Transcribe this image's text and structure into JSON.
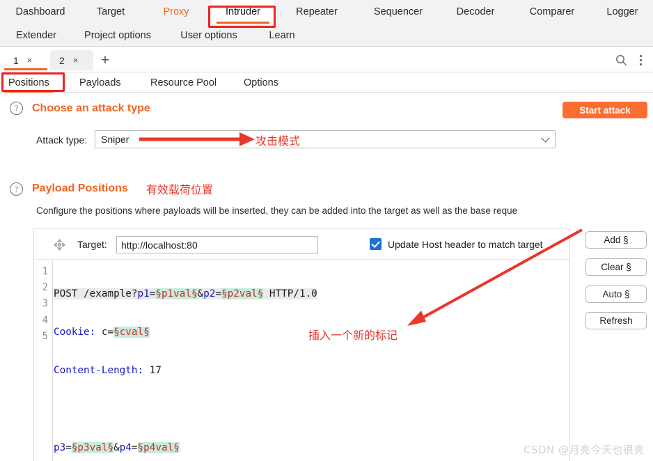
{
  "menu": {
    "row1": [
      {
        "label": "Dashboard",
        "state": "normal"
      },
      {
        "label": "Target",
        "state": "normal"
      },
      {
        "label": "Proxy",
        "state": "highlight"
      },
      {
        "label": "Intruder",
        "state": "active"
      },
      {
        "label": "Repeater",
        "state": "normal"
      },
      {
        "label": "Sequencer",
        "state": "normal"
      },
      {
        "label": "Decoder",
        "state": "normal"
      },
      {
        "label": "Comparer",
        "state": "normal"
      },
      {
        "label": "Logger",
        "state": "normal"
      }
    ],
    "row2": [
      {
        "label": "Extender",
        "state": "normal"
      },
      {
        "label": "Project options",
        "state": "normal"
      },
      {
        "label": "User options",
        "state": "normal"
      },
      {
        "label": "Learn",
        "state": "normal"
      }
    ]
  },
  "attack_tabs": {
    "tabs": [
      {
        "label": "1",
        "close": "×",
        "selected": true
      },
      {
        "label": "2",
        "close": "×",
        "selected": false
      }
    ],
    "add_label": "+",
    "search_icon": "search-icon",
    "menu_icon": "kebab-menu-icon"
  },
  "sub_tabs": [
    {
      "label": "Positions",
      "selected": true
    },
    {
      "label": "Payloads",
      "selected": false
    },
    {
      "label": "Resource Pool",
      "selected": false
    },
    {
      "label": "Options",
      "selected": false
    }
  ],
  "attack_type_section": {
    "help_icon": "?",
    "title": "Choose an attack type",
    "start_attack_label": "Start attack",
    "field_label": "Attack type:",
    "selected_value": "Sniper",
    "annotation_cn": "攻击模式"
  },
  "payload_positions_section": {
    "help_icon": "?",
    "title": "Payload Positions",
    "annotation_cn": "有效载荷位置",
    "description": "Configure the positions where payloads will be inserted, they can be added into the target as well as the base reque"
  },
  "editor": {
    "move_icon": "move-handle-icon",
    "target_label": "Target:",
    "target_value": "http://localhost:80",
    "checkbox_checked": true,
    "checkbox_label": "Update Host header to match target",
    "line_numbers": [
      "1",
      "2",
      "3",
      "4",
      "5"
    ],
    "request_lines": [
      "POST /example?p1=§p1val§&p2=§p2val§ HTTP/1.0",
      "Cookie: c=§cval§",
      "Content-Length: 17",
      "",
      "p3=§p3val§&p4=§p4val§"
    ],
    "marker_char": "§",
    "annotation_cn": "插入一个新的标记"
  },
  "side_buttons": [
    {
      "label": "Add §"
    },
    {
      "label": "Clear §"
    },
    {
      "label": "Auto §"
    },
    {
      "label": "Refresh"
    }
  ],
  "watermark": "CSDN @月亮今天也很亮",
  "colors": {
    "accent_orange": "#f26522",
    "button_orange": "#fa6d32",
    "annotation_red": "#ee2222",
    "marker_bg": "#c8ebdd",
    "marker_fg": "#c03030",
    "code_blue": "#1414c8"
  }
}
